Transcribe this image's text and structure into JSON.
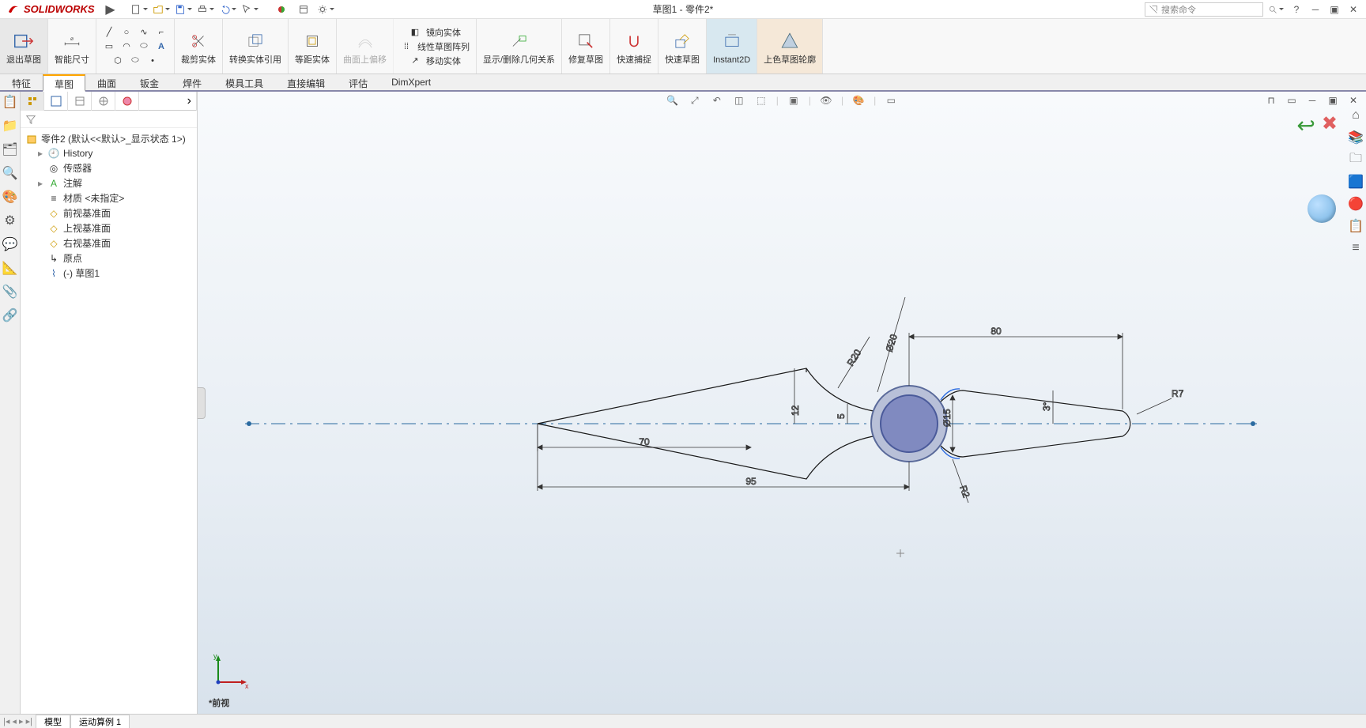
{
  "app": {
    "logo_text": "SOLIDWORKS"
  },
  "title": "草图1 - 零件2*",
  "search_placeholder": "搜索命令",
  "quick_access": [
    "new",
    "open",
    "save",
    "print",
    "undo",
    "select",
    "rebuild",
    "options",
    "settings"
  ],
  "ribbon": {
    "exit_sketch": "退出草图",
    "smart_dim": "智能尺寸",
    "trim": "裁剪实体",
    "convert": "转换实体引用",
    "offset": "等距实体",
    "curve_offset": "曲面上偏移",
    "mirror": "镜向实体",
    "linear_pattern": "线性草图阵列",
    "move": "移动实体",
    "display_delete": "显示/删除几何关系",
    "repair": "修复草图",
    "quick_snap": "快速捕捉",
    "rapid_sketch": "快速草图",
    "instant2d": "Instant2D",
    "shaded_contour": "上色草图轮廓"
  },
  "tabs": [
    "特征",
    "草图",
    "曲面",
    "钣金",
    "焊件",
    "模具工具",
    "直接编辑",
    "评估",
    "DimXpert"
  ],
  "active_tab": "草图",
  "tree": {
    "root": "零件2 (默认<<默认>_显示状态 1>)",
    "items": [
      {
        "label": "History",
        "icon": "history"
      },
      {
        "label": "传感器",
        "icon": "sensor"
      },
      {
        "label": "注解",
        "icon": "annotations",
        "expandable": true
      },
      {
        "label": "材质 <未指定>",
        "icon": "material"
      },
      {
        "label": "前视基准面",
        "icon": "plane"
      },
      {
        "label": "上视基准面",
        "icon": "plane"
      },
      {
        "label": "右视基准面",
        "icon": "plane"
      },
      {
        "label": "原点",
        "icon": "origin"
      },
      {
        "label": "(-) 草图1",
        "icon": "sketch"
      }
    ]
  },
  "view_name": "*前视",
  "dimensions": {
    "d70": "70",
    "d95": "95",
    "d80": "80",
    "d12": "12",
    "d5": "5",
    "dia20": "Ø20",
    "dia15": "Ø15",
    "r20": "R20",
    "r2": "R2",
    "r7": "R7",
    "ang3": "3°"
  },
  "bottom_tabs": [
    "模型",
    "运动算例 1"
  ]
}
